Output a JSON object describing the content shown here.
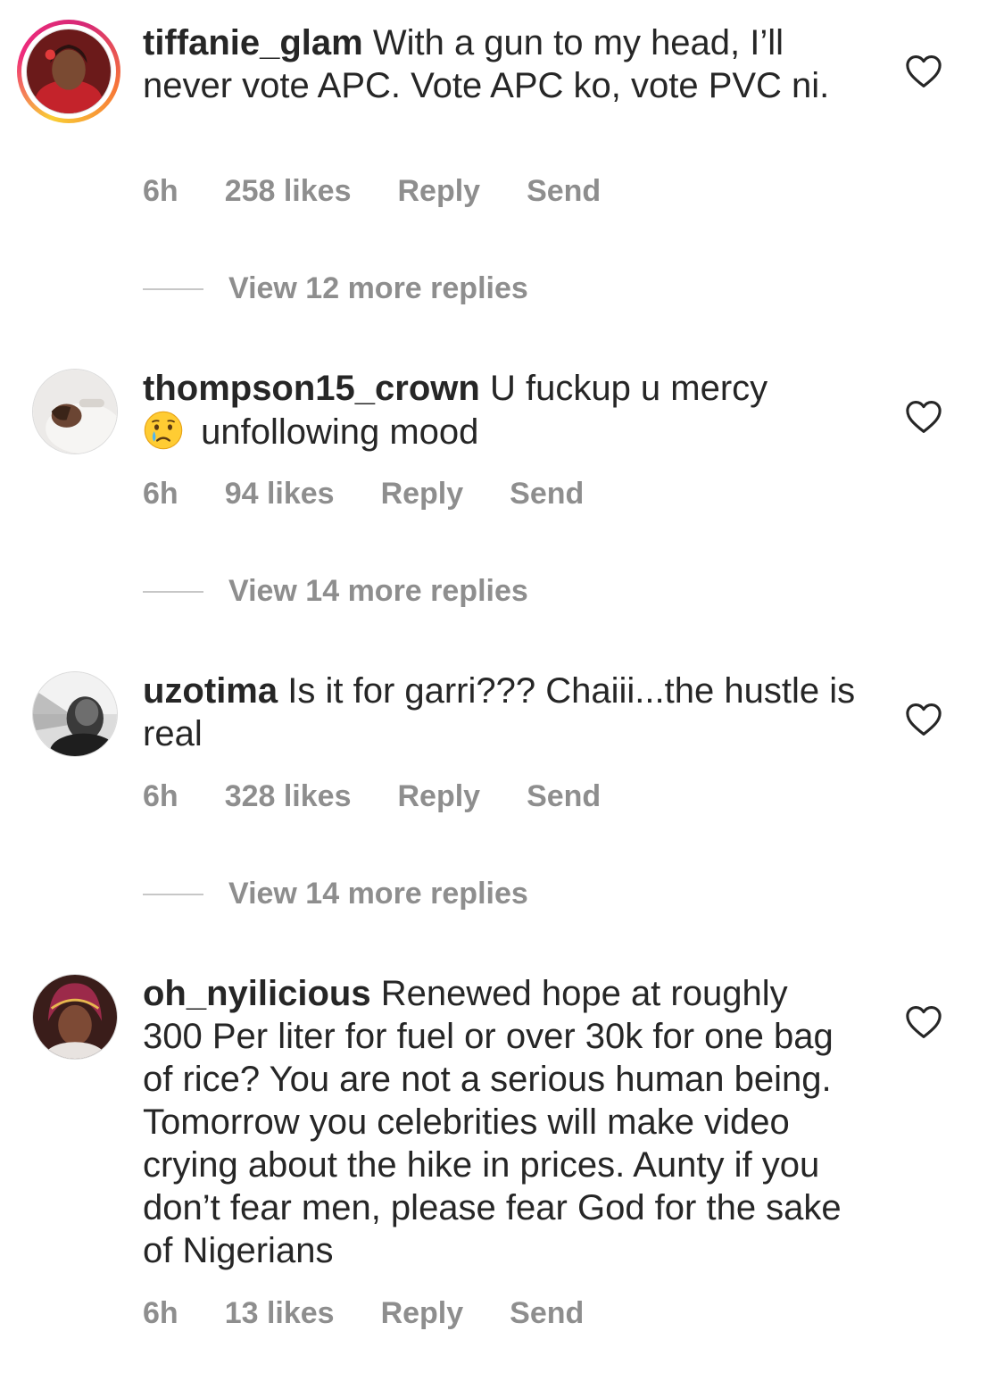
{
  "comments": [
    {
      "username": "tiffanie_glam",
      "text": " With a gun to my head, I’ll never vote APC. Vote APC ko, vote PVC ni.",
      "time": "6h",
      "likes": "258 likes",
      "reply_label": "Reply",
      "send_label": "Send",
      "view_replies": "View 12 more replies"
    },
    {
      "username": "thompson15_crown",
      "text_before": " U fuckup u mercy ",
      "emoji": "crying-face",
      "text_after": " unfollowing mood",
      "time": "6h",
      "likes": "94 likes",
      "reply_label": "Reply",
      "send_label": "Send",
      "view_replies": "View 14 more replies"
    },
    {
      "username": "uzotima",
      "text": " Is it for garri??? Chaiii...the hustle is real",
      "time": "6h",
      "likes": "328 likes",
      "reply_label": "Reply",
      "send_label": "Send",
      "view_replies": "View 14 more replies"
    },
    {
      "username": "oh_nyilicious",
      "text": " Renewed hope at roughly 300 Per liter for fuel or over 30k for one bag of rice? You are not a serious human being. Tomorrow you celebrities will make video crying about the hike in prices. Aunty if you don’t fear men, please fear God for the sake of Nigerians",
      "time": "6h",
      "likes": "13 likes",
      "reply_label": "Reply",
      "send_label": "Send"
    }
  ],
  "colors": {
    "text": "#262626",
    "secondary": "#8e8e8e",
    "divider": "#c7c7c7",
    "story_ring": "#ee2a7b"
  },
  "icons": {
    "like": "heart-outline-icon",
    "emoji": "crying-face-emoji"
  }
}
